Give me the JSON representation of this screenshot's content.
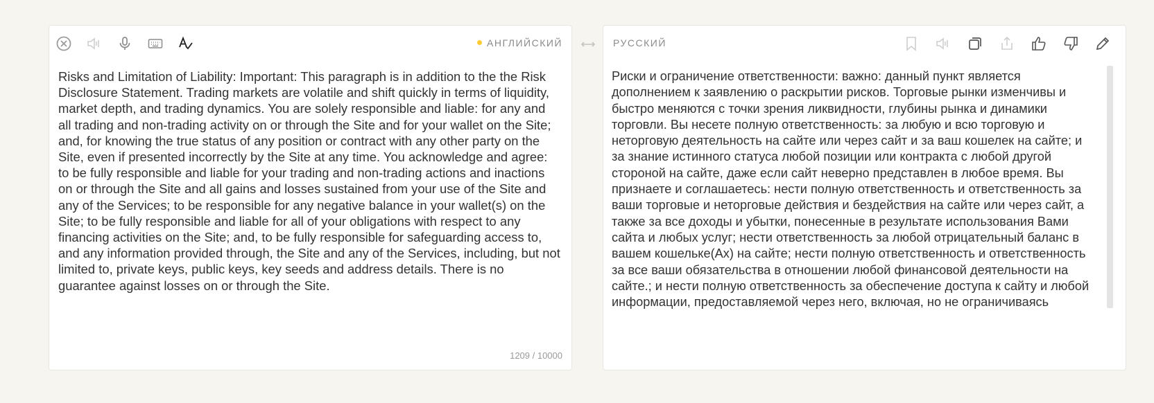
{
  "source": {
    "language": "АНГЛИЙСКИЙ",
    "text": "Risks and Limitation of Liability: Important: This paragraph is in addition to the the Risk Disclosure Statement. Trading markets are volatile and shift quickly in terms of liquidity, market depth, and trading dynamics. You are solely responsible and liable: for any and all trading and non-trading activity on or through the Site and for your wallet on the Site; and, for knowing the true status of any position or contract with any other party on the Site, even if presented incorrectly by the Site at any time. You acknowledge and agree: to be fully responsible and liable for your trading and non-trading actions and inactions on or through the Site and all gains and losses sustained from your use of the Site and any of the Services; to be responsible for any negative balance in your wallet(s) on the Site; to be fully responsible and liable for all of your obligations with respect to any financing activities on the Site; and, to be fully responsible for safeguarding access to, and any information provided through, the Site and any of the Services, including, but not limited to, private keys, public keys, key seeds and address details. There is no guarantee against losses on or through the Site.",
    "counter": "1209 / 10000",
    "icons": [
      "clear-icon",
      "speaker-icon",
      "microphone-icon",
      "keyboard-icon",
      "spellcheck-icon"
    ]
  },
  "target": {
    "language": "РУССКИЙ",
    "text": "Риски и ограничение ответственности: важно: данный пункт является дополнением к заявлению о раскрытии рисков. Торговые рынки изменчивы и быстро меняются с точки зрения ликвидности, глубины рынка и динамики торговли. Вы несете полную ответственность: за любую и всю торговую и неторговую деятельность на сайте или через сайт и за ваш кошелек на сайте; и за знание истинного статуса любой позиции или контракта с любой другой стороной на сайте, даже если сайт неверно представлен в любое время. Вы признаете и соглашаетесь: нести полную ответственность и ответственность за ваши торговые и неторговые действия и бездействия на сайте или через сайт, а также за все доходы и убытки, понесенные в результате использования Вами сайта и любых услуг; нести ответственность за любой отрицательный баланс в вашем кошельке(Ах) на сайте; нести полную ответственность и ответственность за все ваши обязательства в отношении любой финансовой деятельности на сайте.; и нести полную ответственность за обеспечение доступа к сайту и любой информации, предоставляемой через него, включая, но не ограничиваясь",
    "icons": [
      "bookmark-icon",
      "speaker-icon",
      "copy-icon",
      "share-icon",
      "thumbs-up-icon",
      "thumbs-down-icon",
      "edit-icon"
    ]
  },
  "swap_icon": "swap-arrows-icon",
  "colors": {
    "background": "#f6f5f0",
    "panel": "#ffffff",
    "accent_dot": "#ffcc33",
    "icon": "#c6c6c6",
    "icon_dark": "#555555"
  }
}
